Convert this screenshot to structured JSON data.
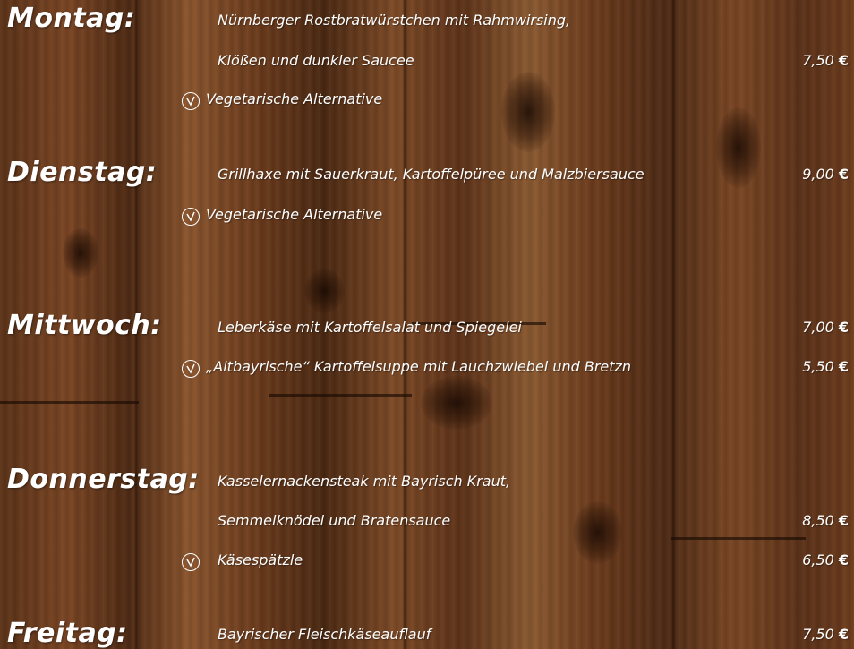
{
  "currency": "€",
  "days": [
    {
      "day": "Montag:",
      "lines": [
        {
          "text": "Nürnberger Rostbratwürstchen mit Rahmwirsing,",
          "price": ""
        },
        {
          "text": "Klößen und dunkler Saucee",
          "price": "7,50"
        },
        {
          "text": "Vegetarische Alternative",
          "price": "",
          "veg": true
        }
      ]
    },
    {
      "day": "Dienstag:",
      "lines": [
        {
          "text": "Grillhaxe mit Sauerkraut, Kartoffelpüree und Malzbiersauce",
          "price": "9,00"
        },
        {
          "text": "Vegetarische Alternative",
          "price": "",
          "veg": true
        }
      ]
    },
    {
      "day": "Mittwoch:",
      "lines": [
        {
          "text": "Leberkäse mit Kartoffelsalat und Spiegelei",
          "price": "7,00"
        },
        {
          "text": "„Altbayrische“ Kartoffelsuppe mit Lauchzwiebel und Bretzn",
          "price": "5,50",
          "veg": true
        }
      ]
    },
    {
      "day": "Donnerstag:",
      "lines": [
        {
          "text": "Kasselernackensteak mit Bayrisch Kraut,",
          "price": ""
        },
        {
          "text": "Semmelknödel und Bratensauce",
          "price": "8,50"
        },
        {
          "text": "Käsespätzle",
          "price": "6,50",
          "veg": true
        }
      ]
    },
    {
      "day": "Freitag:",
      "lines": [
        {
          "text": "Bayrischer Fleischkäseauflauf",
          "price": "7,50"
        }
      ]
    }
  ]
}
